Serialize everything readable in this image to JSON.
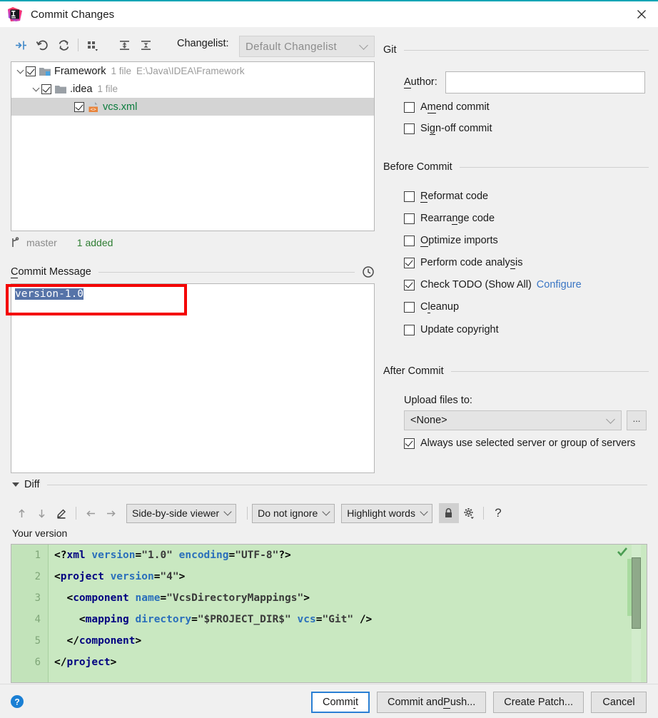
{
  "window": {
    "title": "Commit Changes",
    "app_icon": "intellij-idea-logo",
    "close_icon": "close-icon"
  },
  "toolbar": {
    "buttons": [
      {
        "name": "show-diff-icon",
        "tooltip": "Show Diff"
      },
      {
        "name": "rollback-icon",
        "tooltip": "Rollback"
      },
      {
        "name": "refresh-icon",
        "tooltip": "Refresh"
      },
      {
        "name": "group-by-icon",
        "tooltip": "Group By"
      },
      {
        "name": "expand-all-icon",
        "tooltip": "Expand All"
      },
      {
        "name": "collapse-all-icon",
        "tooltip": "Collapse All"
      }
    ],
    "changelist_label": "Changelist:",
    "changelist_mnemonic": "t",
    "changelist_value": "Default Changelist"
  },
  "tree": {
    "rows": [
      {
        "indent": 0,
        "expander": "expanded",
        "checked": true,
        "icon": "module-folder-icon",
        "name": "Framework",
        "meta": "1 file",
        "path": "E:\\Java\\IDEA\\Framework",
        "selected": false,
        "name_color": "normal"
      },
      {
        "indent": 1,
        "expander": "expanded",
        "checked": true,
        "icon": "folder-icon",
        "name": ".idea",
        "meta": "1 file",
        "path": "",
        "selected": false,
        "name_color": "normal"
      },
      {
        "indent": 2,
        "expander": "none",
        "checked": true,
        "icon": "xml-file-icon",
        "name": "vcs.xml",
        "meta": "",
        "path": "",
        "selected": true,
        "name_color": "green"
      }
    ]
  },
  "branch_row": {
    "icon": "git-branch-icon",
    "branch": "master",
    "status": "1 added"
  },
  "commit_message": {
    "label": "Commit Message",
    "mnemonic": "C",
    "history_icon": "history-clock-icon",
    "value": "version-1.0",
    "selected": true
  },
  "annotation": {
    "type": "red-rectangle-highlight",
    "color": "#f40000"
  },
  "git_section": {
    "title": "Git",
    "author_label": "Author:",
    "author_mnemonic": "A",
    "author_value": "",
    "checkboxes": [
      {
        "label": "Amend commit",
        "mnemonic": "m",
        "checked": false,
        "name": "amend-commit"
      },
      {
        "label": "Sign-off commit",
        "mnemonic": "g",
        "checked": false,
        "name": "sign-off-commit"
      }
    ]
  },
  "before_commit": {
    "title": "Before Commit",
    "checkboxes": [
      {
        "label": "Reformat code",
        "mnemonic": "R",
        "checked": false,
        "name": "reformat-code"
      },
      {
        "label": "Rearrange code",
        "mnemonic": "n",
        "checked": false,
        "name": "rearrange-code"
      },
      {
        "label": "Optimize imports",
        "mnemonic": "O",
        "checked": false,
        "name": "optimize-imports"
      },
      {
        "label": "Perform code analysis",
        "mnemonic": "s",
        "checked": true,
        "name": "perform-code-analysis"
      },
      {
        "label": "Check TODO (Show All)",
        "mnemonic": "",
        "checked": true,
        "name": "check-todo",
        "link": "Configure"
      },
      {
        "label": "Cleanup",
        "mnemonic": "l",
        "checked": false,
        "name": "cleanup"
      },
      {
        "label": "Update copyright",
        "mnemonic": "",
        "checked": false,
        "name": "update-copyright"
      }
    ]
  },
  "after_commit": {
    "title": "After Commit",
    "upload_label": "Upload files to:",
    "upload_value": "<None>",
    "browse_label": "...",
    "always_use": {
      "label": "Always use selected server or group of servers",
      "checked": true
    }
  },
  "diff": {
    "title": "Diff",
    "expanded": true,
    "toolbar_icons": [
      {
        "name": "previous-difference-icon",
        "disabled": true
      },
      {
        "name": "next-difference-icon",
        "disabled": true
      },
      {
        "name": "edit-source-icon",
        "disabled": false
      },
      {
        "name": "accept-left-icon",
        "disabled": true
      },
      {
        "name": "accept-right-icon",
        "disabled": true
      }
    ],
    "viewer_mode": "Side-by-side viewer",
    "ignore_mode": "Do not ignore",
    "highlight_mode": "Highlight words",
    "lock_icon": "lock-icon",
    "lock_toggled": true,
    "settings_icon": "gear-icon",
    "help_icon": "question-mark-icon",
    "pane_label": "Your version",
    "status_icon": "green-checkmark-icon",
    "code": [
      {
        "num": "1",
        "tokens": [
          {
            "t": "<?",
            "c": "punct"
          },
          {
            "t": "xml",
            "c": "tag"
          },
          {
            "t": " ",
            "c": "plain"
          },
          {
            "t": "version",
            "c": "attr"
          },
          {
            "t": "=",
            "c": "punct"
          },
          {
            "t": "\"1.0\"",
            "c": "quote"
          },
          {
            "t": " ",
            "c": "plain"
          },
          {
            "t": "encoding",
            "c": "attr"
          },
          {
            "t": "=",
            "c": "punct"
          },
          {
            "t": "\"UTF-8\"",
            "c": "quote"
          },
          {
            "t": "?>",
            "c": "punct"
          }
        ]
      },
      {
        "num": "2",
        "tokens": [
          {
            "t": "<",
            "c": "punct"
          },
          {
            "t": "project",
            "c": "tag"
          },
          {
            "t": " ",
            "c": "plain"
          },
          {
            "t": "version",
            "c": "attr"
          },
          {
            "t": "=",
            "c": "punct"
          },
          {
            "t": "\"4\"",
            "c": "quote"
          },
          {
            "t": ">",
            "c": "punct"
          }
        ]
      },
      {
        "num": "3",
        "tokens": [
          {
            "t": "  <",
            "c": "punct"
          },
          {
            "t": "component",
            "c": "tag"
          },
          {
            "t": " ",
            "c": "plain"
          },
          {
            "t": "name",
            "c": "attr"
          },
          {
            "t": "=",
            "c": "punct"
          },
          {
            "t": "\"VcsDirectoryMappings\"",
            "c": "quote"
          },
          {
            "t": ">",
            "c": "punct"
          }
        ]
      },
      {
        "num": "4",
        "tokens": [
          {
            "t": "    <",
            "c": "punct"
          },
          {
            "t": "mapping",
            "c": "tag"
          },
          {
            "t": " ",
            "c": "plain"
          },
          {
            "t": "directory",
            "c": "attr"
          },
          {
            "t": "=",
            "c": "punct"
          },
          {
            "t": "\"$PROJECT_DIR$\"",
            "c": "quote"
          },
          {
            "t": " ",
            "c": "plain"
          },
          {
            "t": "vcs",
            "c": "attr"
          },
          {
            "t": "=",
            "c": "punct"
          },
          {
            "t": "\"Git\"",
            "c": "quote"
          },
          {
            "t": " />",
            "c": "punct"
          }
        ]
      },
      {
        "num": "5",
        "tokens": [
          {
            "t": "  </",
            "c": "punct"
          },
          {
            "t": "component",
            "c": "tag"
          },
          {
            "t": ">",
            "c": "punct"
          }
        ]
      },
      {
        "num": "6",
        "tokens": [
          {
            "t": "</",
            "c": "punct"
          },
          {
            "t": "project",
            "c": "tag"
          },
          {
            "t": ">",
            "c": "punct"
          }
        ]
      }
    ]
  },
  "footer": {
    "help_icon": "help-circle-icon",
    "buttons": [
      {
        "label": "Commit",
        "mnemonic": "i",
        "name": "commit-button",
        "default": true
      },
      {
        "label": "Commit and Push...",
        "mnemonic": "P",
        "name": "commit-and-push-button",
        "default": false
      },
      {
        "label": "Create Patch...",
        "mnemonic": "",
        "name": "create-patch-button",
        "default": false
      },
      {
        "label": "Cancel",
        "mnemonic": "",
        "name": "cancel-button",
        "default": false
      }
    ]
  }
}
